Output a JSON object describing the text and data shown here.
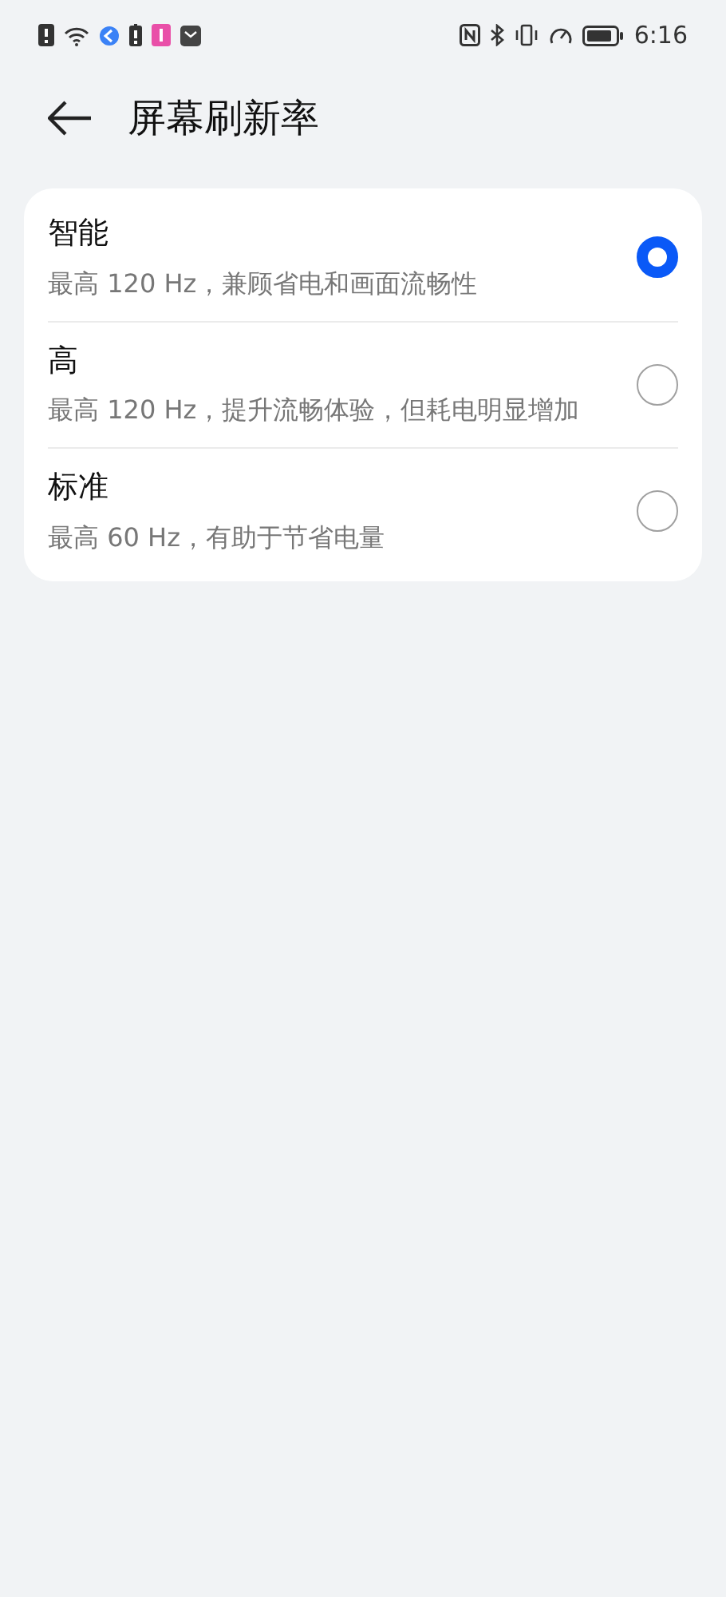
{
  "status_bar": {
    "time": "6:16"
  },
  "header": {
    "title": "屏幕刷新率"
  },
  "options": [
    {
      "label": "智能",
      "description": "最高 120 Hz，兼顾省电和画面流畅性",
      "selected": true
    },
    {
      "label": "高",
      "description": "最高 120 Hz，提升流畅体验，但耗电明显增加",
      "selected": false
    },
    {
      "label": "标准",
      "description": "最高 60 Hz，有助于节省电量",
      "selected": false
    }
  ]
}
